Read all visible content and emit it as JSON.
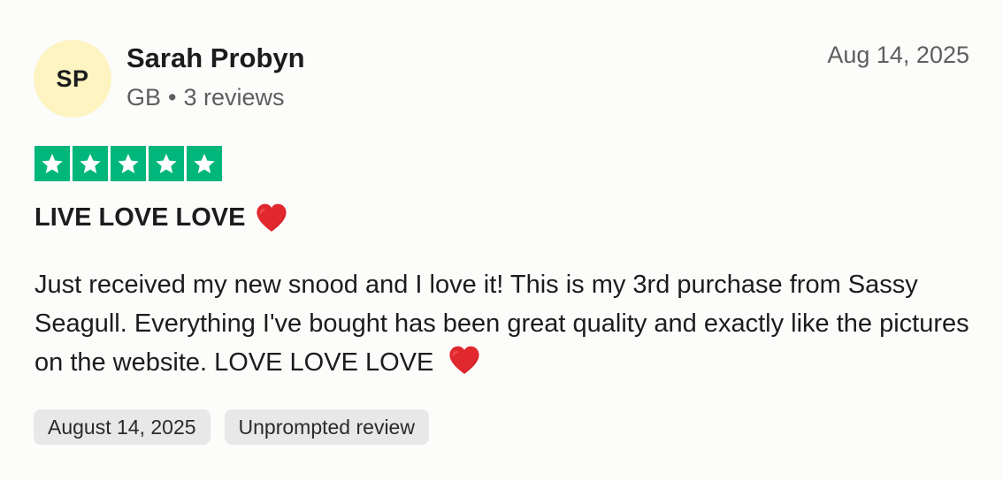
{
  "reviewer": {
    "initials": "SP",
    "name": "Sarah Probyn",
    "country": "GB",
    "separator": "•",
    "reviews_count": "3 reviews",
    "avatar_color": "#fdf4c2"
  },
  "review": {
    "date": "Aug 14, 2025",
    "rating": 5,
    "rating_max": 5,
    "star_color": "#00b67a",
    "title": "LIVE LOVE LOVE",
    "title_icon": "red-heart-icon",
    "body": "Just received my new snood and I love it! This is my 3rd purchase from Sassy Seagull. Everything I've bought has been great quality and exactly like the pictures on the website. LOVE LOVE LOVE",
    "body_icon": "red-heart-icon"
  },
  "chips": {
    "experience_date": "August 14, 2025",
    "review_type": "Unprompted review"
  }
}
